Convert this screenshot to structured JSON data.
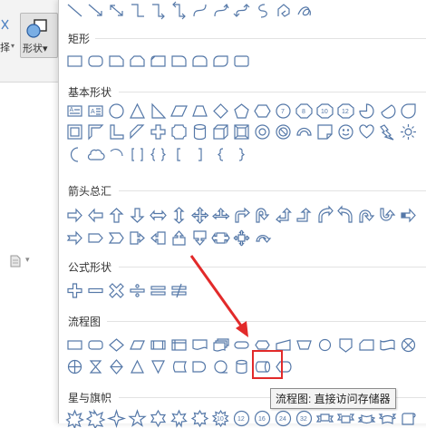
{
  "ribbon": {
    "left_label": "择",
    "left_caret": "▾",
    "shape_button_label": "形状▾"
  },
  "sections": [
    {
      "id": "lines",
      "title": "",
      "shapes": [
        [
          "line-straight",
          "line-arrow",
          "line-double-arrow",
          "elbow",
          "elbow-arrow",
          "elbow-double-arrow",
          "curve",
          "curve-arrow",
          "curve-double-arrow",
          "freeform",
          "freeform-scribble",
          "scribble"
        ]
      ]
    },
    {
      "id": "rectangles",
      "title": "矩形",
      "shapes": [
        [
          "rect",
          "round-rect",
          "snip-1",
          "snip-2",
          "snip-round",
          "round-1",
          "round-2",
          "round-diag",
          "round-rect-small"
        ]
      ]
    },
    {
      "id": "basic",
      "title": "基本形状",
      "shapes": [
        [
          "textbox",
          "vtextbox",
          "ellipse",
          "triangle",
          "right-triangle",
          "parallelogram",
          "trapezoid",
          "diamond",
          "pentagon",
          "hexagon",
          "heptagon",
          "octagon",
          "decagon",
          "dodecagon",
          "pie",
          "chord",
          "teardrop"
        ],
        [
          "frame",
          "half-frame",
          "l-shape",
          "diagonal-stripe",
          "cross",
          "plaque",
          "can",
          "cube",
          "bevel",
          "donut",
          "no-symbol",
          "block-arc",
          "folded-corner",
          "smiley",
          "heart",
          "lightning",
          "sun"
        ],
        [
          "moon",
          "cloud",
          "arc",
          "bracket-pair",
          "brace-pair",
          "left-bracket",
          "right-bracket",
          "left-brace",
          "right-brace"
        ]
      ]
    },
    {
      "id": "arrows",
      "title": "箭头总汇",
      "shapes": [
        [
          "right-arrow",
          "left-arrow",
          "up-arrow",
          "down-arrow",
          "left-right-arrow",
          "up-down-arrow",
          "quad-arrow",
          "left-right-up-arrow",
          "bent-arrow",
          "u-turn-arrow",
          "left-up-arrow",
          "bent-up-arrow",
          "curved-right-arrow",
          "curved-left-arrow",
          "curved-up-arrow",
          "curved-down-arrow",
          "striped-right-arrow"
        ],
        [
          "notched-right-arrow",
          "pentagon-arrow",
          "chevron",
          "right-callout-arrow",
          "left-callout-arrow",
          "up-callout-arrow",
          "down-callout-arrow",
          "left-right-callout",
          "quad-callout",
          "circular-arrow"
        ]
      ]
    },
    {
      "id": "equation",
      "title": "公式形状",
      "shapes": [
        [
          "plus",
          "minus",
          "multiply",
          "divide",
          "equal",
          "not-equal"
        ]
      ]
    },
    {
      "id": "flowchart",
      "title": "流程图",
      "shapes": [
        [
          "fc-process",
          "fc-alt-process",
          "fc-decision",
          "fc-data",
          "fc-predefined",
          "fc-internal-storage",
          "fc-document",
          "fc-multidocument",
          "fc-terminator",
          "fc-preparation",
          "fc-manual-input",
          "fc-manual-operation",
          "fc-connector",
          "fc-offpage",
          "fc-card",
          "fc-punched-tape",
          "fc-summing"
        ],
        [
          "fc-or",
          "fc-collate",
          "fc-sort",
          "fc-extract",
          "fc-merge",
          "fc-stored-data",
          "fc-delay",
          "fc-sequential-access",
          "fc-magnetic-disk",
          "fc-direct-access",
          "fc-display"
        ]
      ]
    },
    {
      "id": "stars",
      "title": "星与旗帜",
      "shapes": [
        [
          "star-explosion1",
          "star-explosion2",
          "star4",
          "star5",
          "star6",
          "star7",
          "star8",
          "star10",
          "star12",
          "star16",
          "star24",
          "star32",
          "ribbon-up",
          "ribbon-down",
          "curved-ribbon-up",
          "curved-ribbon-down",
          "vertical-scroll"
        ]
      ]
    }
  ],
  "tooltip": "流程图: 直接访问存储器",
  "selected_shape": "fc-direct-access",
  "accent_color": "#5578a8",
  "highlight_color": "#e22a2a"
}
